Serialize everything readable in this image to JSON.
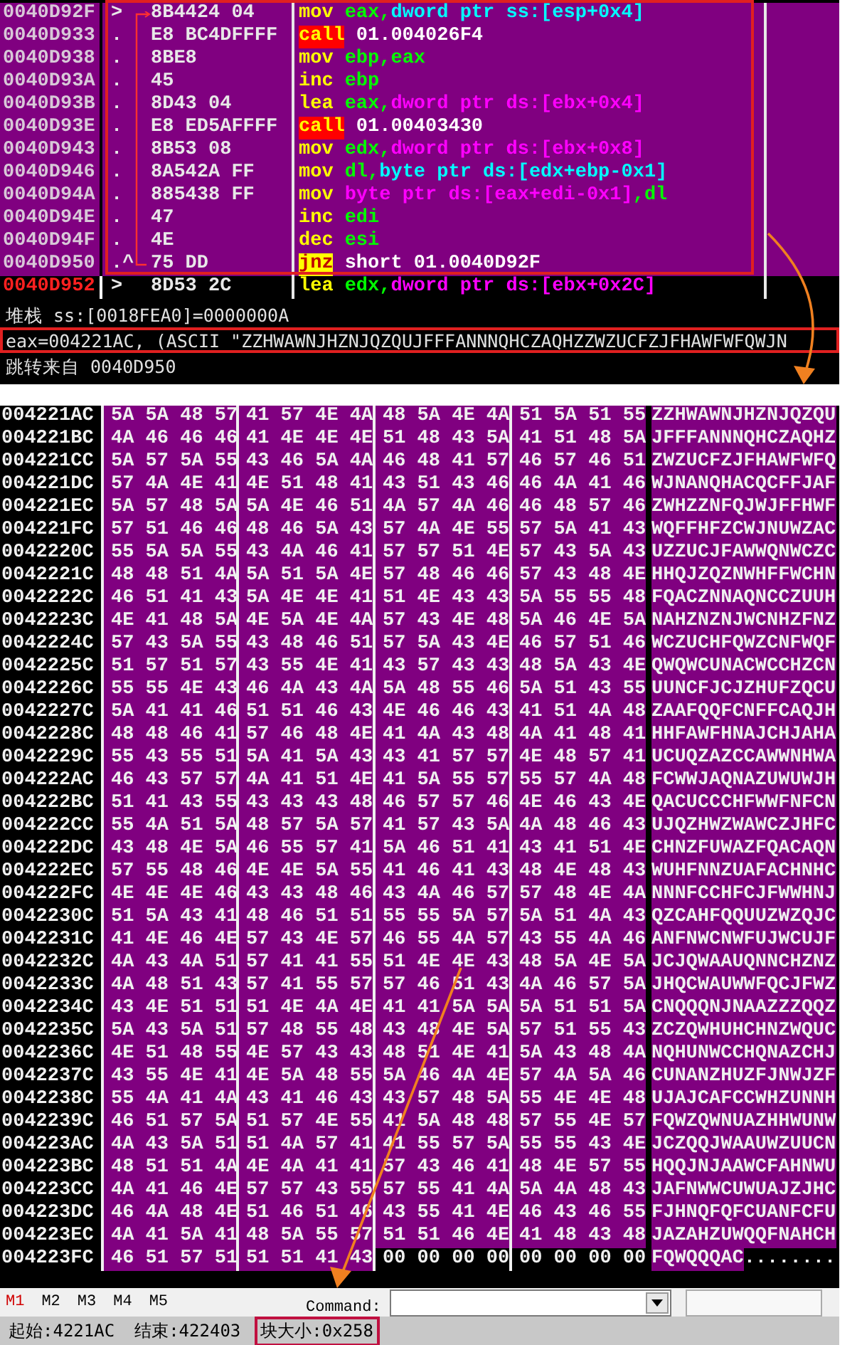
{
  "disassembly": {
    "rows": [
      {
        "address": "0040D92F",
        "marker": ">",
        "bytes": "8B4424 04",
        "mnemonic": {
          "text": "mov",
          "kind": "plain"
        },
        "operands": [
          {
            "text": "eax,",
            "color": "#00ff00"
          },
          {
            "text": "dword ptr ss:[esp+0x4]",
            "color": "#00ffff"
          }
        ],
        "selected": true
      },
      {
        "address": "0040D933",
        "marker": ".",
        "bytes": "E8 BC4DFFFF",
        "mnemonic": {
          "text": "call",
          "kind": "call"
        },
        "operands": [
          {
            "text": "01.004026F4",
            "color": "#ffffff"
          }
        ],
        "selected": true
      },
      {
        "address": "0040D938",
        "marker": ".",
        "bytes": "8BE8",
        "mnemonic": {
          "text": "mov",
          "kind": "plain"
        },
        "operands": [
          {
            "text": "ebp,eax",
            "color": "#00ff00"
          }
        ],
        "selected": true
      },
      {
        "address": "0040D93A",
        "marker": ".",
        "bytes": "45",
        "mnemonic": {
          "text": "inc",
          "kind": "plain"
        },
        "operands": [
          {
            "text": "ebp",
            "color": "#00ff00"
          }
        ],
        "selected": true
      },
      {
        "address": "0040D93B",
        "marker": ".",
        "bytes": "8D43 04",
        "mnemonic": {
          "text": "lea",
          "kind": "plain"
        },
        "operands": [
          {
            "text": "eax,",
            "color": "#00ff00"
          },
          {
            "text": "dword ptr ds:[ebx+0x4]",
            "color": "#ff00ff"
          }
        ],
        "selected": true
      },
      {
        "address": "0040D93E",
        "marker": ".",
        "bytes": "E8 ED5AFFFF",
        "mnemonic": {
          "text": "call",
          "kind": "call"
        },
        "operands": [
          {
            "text": "01.00403430",
            "color": "#ffffff"
          }
        ],
        "selected": true
      },
      {
        "address": "0040D943",
        "marker": ".",
        "bytes": "8B53 08",
        "mnemonic": {
          "text": "mov",
          "kind": "plain"
        },
        "operands": [
          {
            "text": "edx,",
            "color": "#00ff00"
          },
          {
            "text": "dword ptr ds:[ebx+0x8]",
            "color": "#ff00ff"
          }
        ],
        "selected": true
      },
      {
        "address": "0040D946",
        "marker": ".",
        "bytes": "8A542A FF",
        "mnemonic": {
          "text": "mov",
          "kind": "plain"
        },
        "operands": [
          {
            "text": "dl,",
            "color": "#00ff00"
          },
          {
            "text": "byte ptr ds:[edx+ebp-0x1]",
            "color": "#00ffff"
          }
        ],
        "selected": true
      },
      {
        "address": "0040D94A",
        "marker": ".",
        "bytes": "885438 FF",
        "mnemonic": {
          "text": "mov",
          "kind": "plain"
        },
        "operands": [
          {
            "text": "byte ptr ds:[eax+edi-0x1]",
            "color": "#ff00ff"
          },
          {
            "text": ",dl",
            "color": "#00ff00"
          }
        ],
        "selected": true
      },
      {
        "address": "0040D94E",
        "marker": ".",
        "bytes": "47",
        "mnemonic": {
          "text": "inc",
          "kind": "plain"
        },
        "operands": [
          {
            "text": "edi",
            "color": "#00ff00"
          }
        ],
        "selected": true
      },
      {
        "address": "0040D94F",
        "marker": ".",
        "bytes": "4E",
        "mnemonic": {
          "text": "dec",
          "kind": "plain"
        },
        "operands": [
          {
            "text": "esi",
            "color": "#00ff00"
          }
        ],
        "selected": true
      },
      {
        "address": "0040D950",
        "marker": ".^",
        "bytes": "75 DD",
        "mnemonic": {
          "text": "jnz",
          "kind": "jump"
        },
        "operands": [
          {
            "text": "short 01.0040D92F",
            "color": "#ffffff"
          }
        ],
        "selected": true
      },
      {
        "address": "0040D952",
        "marker": ">",
        "bytes": "8D53 2C",
        "mnemonic": {
          "text": "lea",
          "kind": "plain"
        },
        "operands": [
          {
            "text": "edx,",
            "color": "#00ff00"
          },
          {
            "text": "dword ptr ds:[ebx+0x2C]",
            "color": "#ff00ff"
          }
        ],
        "selected": false
      }
    ]
  },
  "info": {
    "lines": [
      {
        "text": "堆栈 ss:[0018FEA0]=0000000A",
        "framed": false
      },
      {
        "text": "eax=004221AC, (ASCII \"ZZHWAWNJHZNJQZQUJFFFANNNQHCZAQHZZWZUCFZJFHAWFWFQWJN",
        "framed": true
      },
      {
        "text": "跳转来自 0040D950",
        "framed": false
      }
    ]
  },
  "dump": {
    "rows": [
      {
        "address": "004221AC",
        "groups": [
          {
            "hex": "5A 5A 48 57",
            "selected": true
          },
          {
            "hex": "41 57 4E 4A",
            "selected": true
          },
          {
            "hex": "48 5A 4E 4A",
            "selected": true
          },
          {
            "hex": "51 5A 51 55",
            "selected": true
          }
        ],
        "ascii": [
          {
            "text": "ZZHWAWNJHZNJQZQU",
            "selected": true
          }
        ]
      },
      {
        "address": "004221BC",
        "groups": [
          {
            "hex": "4A 46 46 46",
            "selected": true
          },
          {
            "hex": "41 4E 4E 4E",
            "selected": true
          },
          {
            "hex": "51 48 43 5A",
            "selected": true
          },
          {
            "hex": "41 51 48 5A",
            "selected": true
          }
        ],
        "ascii": [
          {
            "text": "JFFFANNNQHCZAQHZ",
            "selected": true
          }
        ]
      },
      {
        "address": "004221CC",
        "groups": [
          {
            "hex": "5A 57 5A 55",
            "selected": true
          },
          {
            "hex": "43 46 5A 4A",
            "selected": true
          },
          {
            "hex": "46 48 41 57",
            "selected": true
          },
          {
            "hex": "46 57 46 51",
            "selected": true
          }
        ],
        "ascii": [
          {
            "text": "ZWZUCFZJFHAWFWFQ",
            "selected": true
          }
        ]
      },
      {
        "address": "004221DC",
        "groups": [
          {
            "hex": "57 4A 4E 41",
            "selected": true
          },
          {
            "hex": "4E 51 48 41",
            "selected": true
          },
          {
            "hex": "43 51 43 46",
            "selected": true
          },
          {
            "hex": "46 4A 41 46",
            "selected": true
          }
        ],
        "ascii": [
          {
            "text": "WJNANQHACQCFFJAF",
            "selected": true
          }
        ]
      },
      {
        "address": "004221EC",
        "groups": [
          {
            "hex": "5A 57 48 5A",
            "selected": true
          },
          {
            "hex": "5A 4E 46 51",
            "selected": true
          },
          {
            "hex": "4A 57 4A 46",
            "selected": true
          },
          {
            "hex": "46 48 57 46",
            "selected": true
          }
        ],
        "ascii": [
          {
            "text": "ZWHZZNFQJWJFFHWF",
            "selected": true
          }
        ]
      },
      {
        "address": "004221FC",
        "groups": [
          {
            "hex": "57 51 46 46",
            "selected": true
          },
          {
            "hex": "48 46 5A 43",
            "selected": true
          },
          {
            "hex": "57 4A 4E 55",
            "selected": true
          },
          {
            "hex": "57 5A 41 43",
            "selected": true
          }
        ],
        "ascii": [
          {
            "text": "WQFFHFZCWJNUWZAC",
            "selected": true
          }
        ]
      },
      {
        "address": "0042220C",
        "groups": [
          {
            "hex": "55 5A 5A 55",
            "selected": true
          },
          {
            "hex": "43 4A 46 41",
            "selected": true
          },
          {
            "hex": "57 57 51 4E",
            "selected": true
          },
          {
            "hex": "57 43 5A 43",
            "selected": true
          }
        ],
        "ascii": [
          {
            "text": "UZZUCJFAWWQNWCZC",
            "selected": true
          }
        ]
      },
      {
        "address": "0042221C",
        "groups": [
          {
            "hex": "48 48 51 4A",
            "selected": true
          },
          {
            "hex": "5A 51 5A 4E",
            "selected": true
          },
          {
            "hex": "57 48 46 46",
            "selected": true
          },
          {
            "hex": "57 43 48 4E",
            "selected": true
          }
        ],
        "ascii": [
          {
            "text": "HHQJZQZNWHFFWCHN",
            "selected": true
          }
        ]
      },
      {
        "address": "0042222C",
        "groups": [
          {
            "hex": "46 51 41 43",
            "selected": true
          },
          {
            "hex": "5A 4E 4E 41",
            "selected": true
          },
          {
            "hex": "51 4E 43 43",
            "selected": true
          },
          {
            "hex": "5A 55 55 48",
            "selected": true
          }
        ],
        "ascii": [
          {
            "text": "FQACZNNAQNCCZUUH",
            "selected": true
          }
        ]
      },
      {
        "address": "0042223C",
        "groups": [
          {
            "hex": "4E 41 48 5A",
            "selected": true
          },
          {
            "hex": "4E 5A 4E 4A",
            "selected": true
          },
          {
            "hex": "57 43 4E 48",
            "selected": true
          },
          {
            "hex": "5A 46 4E 5A",
            "selected": true
          }
        ],
        "ascii": [
          {
            "text": "NAHZNZNJWCNHZFNZ",
            "selected": true
          }
        ]
      },
      {
        "address": "0042224C",
        "groups": [
          {
            "hex": "57 43 5A 55",
            "selected": true
          },
          {
            "hex": "43 48 46 51",
            "selected": true
          },
          {
            "hex": "57 5A 43 4E",
            "selected": true
          },
          {
            "hex": "46 57 51 46",
            "selected": true
          }
        ],
        "ascii": [
          {
            "text": "WCZUCHFQWZCNFWQF",
            "selected": true
          }
        ]
      },
      {
        "address": "0042225C",
        "groups": [
          {
            "hex": "51 57 51 57",
            "selected": true
          },
          {
            "hex": "43 55 4E 41",
            "selected": true
          },
          {
            "hex": "43 57 43 43",
            "selected": true
          },
          {
            "hex": "48 5A 43 4E",
            "selected": true
          }
        ],
        "ascii": [
          {
            "text": "QWQWCUNACWCCHZCN",
            "selected": true
          }
        ]
      },
      {
        "address": "0042226C",
        "groups": [
          {
            "hex": "55 55 4E 43",
            "selected": true
          },
          {
            "hex": "46 4A 43 4A",
            "selected": true
          },
          {
            "hex": "5A 48 55 46",
            "selected": true
          },
          {
            "hex": "5A 51 43 55",
            "selected": true
          }
        ],
        "ascii": [
          {
            "text": "UUNCFJCJZHUFZQCU",
            "selected": true
          }
        ]
      },
      {
        "address": "0042227C",
        "groups": [
          {
            "hex": "5A 41 41 46",
            "selected": true
          },
          {
            "hex": "51 51 46 43",
            "selected": true
          },
          {
            "hex": "4E 46 46 43",
            "selected": true
          },
          {
            "hex": "41 51 4A 48",
            "selected": true
          }
        ],
        "ascii": [
          {
            "text": "ZAAFQQFCNFFCAQJH",
            "selected": true
          }
        ]
      },
      {
        "address": "0042228C",
        "groups": [
          {
            "hex": "48 48 46 41",
            "selected": true
          },
          {
            "hex": "57 46 48 4E",
            "selected": true
          },
          {
            "hex": "41 4A 43 48",
            "selected": true
          },
          {
            "hex": "4A 41 48 41",
            "selected": true
          }
        ],
        "ascii": [
          {
            "text": "HHFAWFHNAJCHJAHA",
            "selected": true
          }
        ]
      },
      {
        "address": "0042229C",
        "groups": [
          {
            "hex": "55 43 55 51",
            "selected": true
          },
          {
            "hex": "5A 41 5A 43",
            "selected": true
          },
          {
            "hex": "43 41 57 57",
            "selected": true
          },
          {
            "hex": "4E 48 57 41",
            "selected": true
          }
        ],
        "ascii": [
          {
            "text": "UCUQZAZCCAWWNHWA",
            "selected": true
          }
        ]
      },
      {
        "address": "004222AC",
        "groups": [
          {
            "hex": "46 43 57 57",
            "selected": true
          },
          {
            "hex": "4A 41 51 4E",
            "selected": true
          },
          {
            "hex": "41 5A 55 57",
            "selected": true
          },
          {
            "hex": "55 57 4A 48",
            "selected": true
          }
        ],
        "ascii": [
          {
            "text": "FCWWJAQNAZUWUWJH",
            "selected": true
          }
        ]
      },
      {
        "address": "004222BC",
        "groups": [
          {
            "hex": "51 41 43 55",
            "selected": true
          },
          {
            "hex": "43 43 43 48",
            "selected": true
          },
          {
            "hex": "46 57 57 46",
            "selected": true
          },
          {
            "hex": "4E 46 43 4E",
            "selected": true
          }
        ],
        "ascii": [
          {
            "text": "QACUCCCHFWWFNFCN",
            "selected": true
          }
        ]
      },
      {
        "address": "004222CC",
        "groups": [
          {
            "hex": "55 4A 51 5A",
            "selected": true
          },
          {
            "hex": "48 57 5A 57",
            "selected": true
          },
          {
            "hex": "41 57 43 5A",
            "selected": true
          },
          {
            "hex": "4A 48 46 43",
            "selected": true
          }
        ],
        "ascii": [
          {
            "text": "UJQZHWZWAWCZJHFC",
            "selected": true
          }
        ]
      },
      {
        "address": "004222DC",
        "groups": [
          {
            "hex": "43 48 4E 5A",
            "selected": true
          },
          {
            "hex": "46 55 57 41",
            "selected": true
          },
          {
            "hex": "5A 46 51 41",
            "selected": true
          },
          {
            "hex": "43 41 51 4E",
            "selected": true
          }
        ],
        "ascii": [
          {
            "text": "CHNZFUWAZFQACAQN",
            "selected": true
          }
        ]
      },
      {
        "address": "004222EC",
        "groups": [
          {
            "hex": "57 55 48 46",
            "selected": true
          },
          {
            "hex": "4E 4E 5A 55",
            "selected": true
          },
          {
            "hex": "41 46 41 43",
            "selected": true
          },
          {
            "hex": "48 4E 48 43",
            "selected": true
          }
        ],
        "ascii": [
          {
            "text": "WUHFNNZUAFACHNHC",
            "selected": true
          }
        ]
      },
      {
        "address": "004222FC",
        "groups": [
          {
            "hex": "4E 4E 4E 46",
            "selected": true
          },
          {
            "hex": "43 43 48 46",
            "selected": true
          },
          {
            "hex": "43 4A 46 57",
            "selected": true
          },
          {
            "hex": "57 48 4E 4A",
            "selected": true
          }
        ],
        "ascii": [
          {
            "text": "NNNFCCHFCJFWWHNJ",
            "selected": true
          }
        ]
      },
      {
        "address": "0042230C",
        "groups": [
          {
            "hex": "51 5A 43 41",
            "selected": true
          },
          {
            "hex": "48 46 51 51",
            "selected": true
          },
          {
            "hex": "55 55 5A 57",
            "selected": true
          },
          {
            "hex": "5A 51 4A 43",
            "selected": true
          }
        ],
        "ascii": [
          {
            "text": "QZCAHFQQUUZWZQJC",
            "selected": true
          }
        ]
      },
      {
        "address": "0042231C",
        "groups": [
          {
            "hex": "41 4E 46 4E",
            "selected": true
          },
          {
            "hex": "57 43 4E 57",
            "selected": true
          },
          {
            "hex": "46 55 4A 57",
            "selected": true
          },
          {
            "hex": "43 55 4A 46",
            "selected": true
          }
        ],
        "ascii": [
          {
            "text": "ANFNWCNWFUJWCUJF",
            "selected": true
          }
        ]
      },
      {
        "address": "0042232C",
        "groups": [
          {
            "hex": "4A 43 4A 51",
            "selected": true
          },
          {
            "hex": "57 41 41 55",
            "selected": true
          },
          {
            "hex": "51 4E 4E 43",
            "selected": true
          },
          {
            "hex": "48 5A 4E 5A",
            "selected": true
          }
        ],
        "ascii": [
          {
            "text": "JCJQWAAUQNNCHZNZ",
            "selected": true
          }
        ]
      },
      {
        "address": "0042233C",
        "groups": [
          {
            "hex": "4A 48 51 43",
            "selected": true
          },
          {
            "hex": "57 41 55 57",
            "selected": true
          },
          {
            "hex": "57 46 51 43",
            "selected": true
          },
          {
            "hex": "4A 46 57 5A",
            "selected": true
          }
        ],
        "ascii": [
          {
            "text": "JHQCWAUWWFQCJFWZ",
            "selected": true
          }
        ]
      },
      {
        "address": "0042234C",
        "groups": [
          {
            "hex": "43 4E 51 51",
            "selected": true
          },
          {
            "hex": "51 4E 4A 4E",
            "selected": true
          },
          {
            "hex": "41 41 5A 5A",
            "selected": true
          },
          {
            "hex": "5A 51 51 5A",
            "selected": true
          }
        ],
        "ascii": [
          {
            "text": "CNQQQNJNAAZZZQQZ",
            "selected": true
          }
        ]
      },
      {
        "address": "0042235C",
        "groups": [
          {
            "hex": "5A 43 5A 51",
            "selected": true
          },
          {
            "hex": "57 48 55 48",
            "selected": true
          },
          {
            "hex": "43 48 4E 5A",
            "selected": true
          },
          {
            "hex": "57 51 55 43",
            "selected": true
          }
        ],
        "ascii": [
          {
            "text": "ZCZQWHUHCHNZWQUC",
            "selected": true
          }
        ]
      },
      {
        "address": "0042236C",
        "groups": [
          {
            "hex": "4E 51 48 55",
            "selected": true
          },
          {
            "hex": "4E 57 43 43",
            "selected": true
          },
          {
            "hex": "48 51 4E 41",
            "selected": true
          },
          {
            "hex": "5A 43 48 4A",
            "selected": true
          }
        ],
        "ascii": [
          {
            "text": "NQHUNWCCHQNAZCHJ",
            "selected": true
          }
        ]
      },
      {
        "address": "0042237C",
        "groups": [
          {
            "hex": "43 55 4E 41",
            "selected": true
          },
          {
            "hex": "4E 5A 48 55",
            "selected": true
          },
          {
            "hex": "5A 46 4A 4E",
            "selected": true
          },
          {
            "hex": "57 4A 5A 46",
            "selected": true
          }
        ],
        "ascii": [
          {
            "text": "CUNANZHUZFJNWJZF",
            "selected": true
          }
        ]
      },
      {
        "address": "0042238C",
        "groups": [
          {
            "hex": "55 4A 41 4A",
            "selected": true
          },
          {
            "hex": "43 41 46 43",
            "selected": true
          },
          {
            "hex": "43 57 48 5A",
            "selected": true
          },
          {
            "hex": "55 4E 4E 48",
            "selected": true
          }
        ],
        "ascii": [
          {
            "text": "UJAJCAFCCWHZUNNH",
            "selected": true
          }
        ]
      },
      {
        "address": "0042239C",
        "groups": [
          {
            "hex": "46 51 57 5A",
            "selected": true
          },
          {
            "hex": "51 57 4E 55",
            "selected": true
          },
          {
            "hex": "41 5A 48 48",
            "selected": true
          },
          {
            "hex": "57 55 4E 57",
            "selected": true
          }
        ],
        "ascii": [
          {
            "text": "FQWZQWNUAZHHWUNW",
            "selected": true
          }
        ]
      },
      {
        "address": "004223AC",
        "groups": [
          {
            "hex": "4A 43 5A 51",
            "selected": true
          },
          {
            "hex": "51 4A 57 41",
            "selected": true
          },
          {
            "hex": "41 55 57 5A",
            "selected": true
          },
          {
            "hex": "55 55 43 4E",
            "selected": true
          }
        ],
        "ascii": [
          {
            "text": "JCZQQJWAAUWZUUCN",
            "selected": true
          }
        ]
      },
      {
        "address": "004223BC",
        "groups": [
          {
            "hex": "48 51 51 4A",
            "selected": true
          },
          {
            "hex": "4E 4A 41 41",
            "selected": true
          },
          {
            "hex": "57 43 46 41",
            "selected": true
          },
          {
            "hex": "48 4E 57 55",
            "selected": true
          }
        ],
        "ascii": [
          {
            "text": "HQQJNJAAWCFAHNWU",
            "selected": true
          }
        ]
      },
      {
        "address": "004223CC",
        "groups": [
          {
            "hex": "4A 41 46 4E",
            "selected": true
          },
          {
            "hex": "57 57 43 55",
            "selected": true
          },
          {
            "hex": "57 55 41 4A",
            "selected": true
          },
          {
            "hex": "5A 4A 48 43",
            "selected": true
          }
        ],
        "ascii": [
          {
            "text": "JAFNWWCUWUAJZJHC",
            "selected": true
          }
        ]
      },
      {
        "address": "004223DC",
        "groups": [
          {
            "hex": "46 4A 48 4E",
            "selected": true
          },
          {
            "hex": "51 46 51 46",
            "selected": true
          },
          {
            "hex": "43 55 41 4E",
            "selected": true
          },
          {
            "hex": "46 43 46 55",
            "selected": true
          }
        ],
        "ascii": [
          {
            "text": "FJHNQFQFCUANFCFU",
            "selected": true
          }
        ]
      },
      {
        "address": "004223EC",
        "groups": [
          {
            "hex": "4A 41 5A 41",
            "selected": true
          },
          {
            "hex": "48 5A 55 57",
            "selected": true
          },
          {
            "hex": "51 51 46 4E",
            "selected": true
          },
          {
            "hex": "41 48 43 48",
            "selected": true
          }
        ],
        "ascii": [
          {
            "text": "JAZAHZUWQQFNAHCH",
            "selected": true
          }
        ]
      },
      {
        "address": "004223FC",
        "groups": [
          {
            "hex": "46 51 57 51",
            "selected": true
          },
          {
            "hex": "51 51 41 43",
            "selected": true
          },
          {
            "hex": "00 00 00 00",
            "selected": false
          },
          {
            "hex": "00 00 00 00",
            "selected": false
          }
        ],
        "ascii": [
          {
            "text": "FQWQQQAC",
            "selected": true
          },
          {
            "text": "........",
            "selected": false
          }
        ]
      }
    ]
  },
  "toolbar": {
    "tabs": [
      {
        "label": "M1",
        "selected": true
      },
      {
        "label": "M2",
        "selected": false
      },
      {
        "label": "M3",
        "selected": false
      },
      {
        "label": "M4",
        "selected": false
      },
      {
        "label": "M5",
        "selected": false
      }
    ],
    "command_label": "Command:"
  },
  "status_bar": [
    {
      "text": "起始:4221AC",
      "framed": false
    },
    {
      "text": "结束:422403",
      "framed": false
    },
    {
      "text": "块大小:0x258",
      "framed": true
    }
  ]
}
